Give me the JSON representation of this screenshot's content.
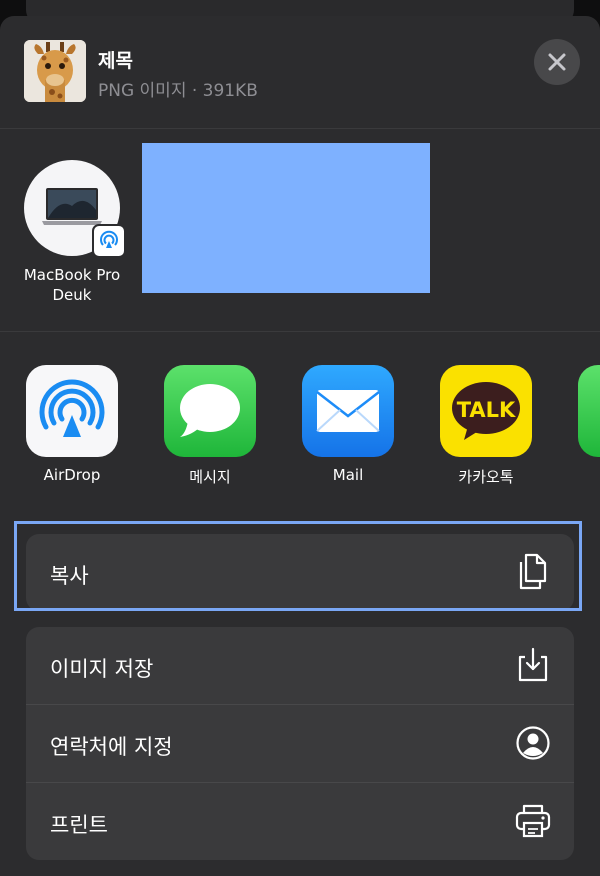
{
  "header": {
    "title": "제목",
    "subtitle": "PNG 이미지 · 391KB"
  },
  "people": [
    {
      "name_line1": "MacBook Pro",
      "name_line2": "Deuk"
    }
  ],
  "apps": [
    {
      "label": "AirDrop"
    },
    {
      "label": "메시지"
    },
    {
      "label": "Mail"
    },
    {
      "label": "카카오톡",
      "icon_text": "TALK"
    }
  ],
  "actions": {
    "copy": "복사",
    "save_image": "이미지 저장",
    "assign_contact": "연락처에 지정",
    "print": "프린트"
  },
  "colors": {
    "sheet": "#2c2c2e",
    "card": "#3a3a3c",
    "highlight": "#7aa7f5",
    "airdrop_blue": "#1a8cf2",
    "messages_green": "#34c759",
    "mail_blue": "#1d8cf8",
    "kakao_yellow": "#fae100"
  }
}
